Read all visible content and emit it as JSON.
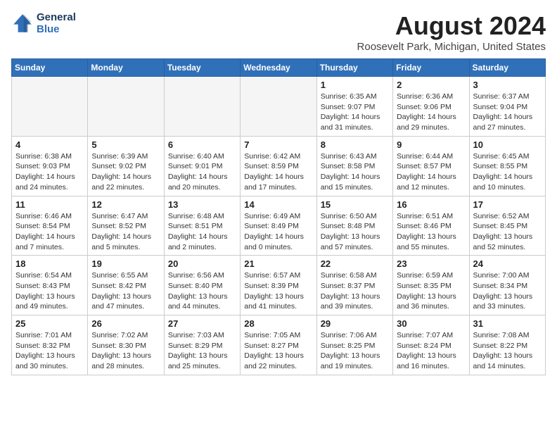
{
  "header": {
    "logo_line1": "General",
    "logo_line2": "Blue",
    "month_year": "August 2024",
    "location": "Roosevelt Park, Michigan, United States"
  },
  "days_of_week": [
    "Sunday",
    "Monday",
    "Tuesday",
    "Wednesday",
    "Thursday",
    "Friday",
    "Saturday"
  ],
  "weeks": [
    [
      {
        "day": "",
        "info": ""
      },
      {
        "day": "",
        "info": ""
      },
      {
        "day": "",
        "info": ""
      },
      {
        "day": "",
        "info": ""
      },
      {
        "day": "1",
        "info": "Sunrise: 6:35 AM\nSunset: 9:07 PM\nDaylight: 14 hours\nand 31 minutes."
      },
      {
        "day": "2",
        "info": "Sunrise: 6:36 AM\nSunset: 9:06 PM\nDaylight: 14 hours\nand 29 minutes."
      },
      {
        "day": "3",
        "info": "Sunrise: 6:37 AM\nSunset: 9:04 PM\nDaylight: 14 hours\nand 27 minutes."
      }
    ],
    [
      {
        "day": "4",
        "info": "Sunrise: 6:38 AM\nSunset: 9:03 PM\nDaylight: 14 hours\nand 24 minutes."
      },
      {
        "day": "5",
        "info": "Sunrise: 6:39 AM\nSunset: 9:02 PM\nDaylight: 14 hours\nand 22 minutes."
      },
      {
        "day": "6",
        "info": "Sunrise: 6:40 AM\nSunset: 9:01 PM\nDaylight: 14 hours\nand 20 minutes."
      },
      {
        "day": "7",
        "info": "Sunrise: 6:42 AM\nSunset: 8:59 PM\nDaylight: 14 hours\nand 17 minutes."
      },
      {
        "day": "8",
        "info": "Sunrise: 6:43 AM\nSunset: 8:58 PM\nDaylight: 14 hours\nand 15 minutes."
      },
      {
        "day": "9",
        "info": "Sunrise: 6:44 AM\nSunset: 8:57 PM\nDaylight: 14 hours\nand 12 minutes."
      },
      {
        "day": "10",
        "info": "Sunrise: 6:45 AM\nSunset: 8:55 PM\nDaylight: 14 hours\nand 10 minutes."
      }
    ],
    [
      {
        "day": "11",
        "info": "Sunrise: 6:46 AM\nSunset: 8:54 PM\nDaylight: 14 hours\nand 7 minutes."
      },
      {
        "day": "12",
        "info": "Sunrise: 6:47 AM\nSunset: 8:52 PM\nDaylight: 14 hours\nand 5 minutes."
      },
      {
        "day": "13",
        "info": "Sunrise: 6:48 AM\nSunset: 8:51 PM\nDaylight: 14 hours\nand 2 minutes."
      },
      {
        "day": "14",
        "info": "Sunrise: 6:49 AM\nSunset: 8:49 PM\nDaylight: 14 hours\nand 0 minutes."
      },
      {
        "day": "15",
        "info": "Sunrise: 6:50 AM\nSunset: 8:48 PM\nDaylight: 13 hours\nand 57 minutes."
      },
      {
        "day": "16",
        "info": "Sunrise: 6:51 AM\nSunset: 8:46 PM\nDaylight: 13 hours\nand 55 minutes."
      },
      {
        "day": "17",
        "info": "Sunrise: 6:52 AM\nSunset: 8:45 PM\nDaylight: 13 hours\nand 52 minutes."
      }
    ],
    [
      {
        "day": "18",
        "info": "Sunrise: 6:54 AM\nSunset: 8:43 PM\nDaylight: 13 hours\nand 49 minutes."
      },
      {
        "day": "19",
        "info": "Sunrise: 6:55 AM\nSunset: 8:42 PM\nDaylight: 13 hours\nand 47 minutes."
      },
      {
        "day": "20",
        "info": "Sunrise: 6:56 AM\nSunset: 8:40 PM\nDaylight: 13 hours\nand 44 minutes."
      },
      {
        "day": "21",
        "info": "Sunrise: 6:57 AM\nSunset: 8:39 PM\nDaylight: 13 hours\nand 41 minutes."
      },
      {
        "day": "22",
        "info": "Sunrise: 6:58 AM\nSunset: 8:37 PM\nDaylight: 13 hours\nand 39 minutes."
      },
      {
        "day": "23",
        "info": "Sunrise: 6:59 AM\nSunset: 8:35 PM\nDaylight: 13 hours\nand 36 minutes."
      },
      {
        "day": "24",
        "info": "Sunrise: 7:00 AM\nSunset: 8:34 PM\nDaylight: 13 hours\nand 33 minutes."
      }
    ],
    [
      {
        "day": "25",
        "info": "Sunrise: 7:01 AM\nSunset: 8:32 PM\nDaylight: 13 hours\nand 30 minutes."
      },
      {
        "day": "26",
        "info": "Sunrise: 7:02 AM\nSunset: 8:30 PM\nDaylight: 13 hours\nand 28 minutes."
      },
      {
        "day": "27",
        "info": "Sunrise: 7:03 AM\nSunset: 8:29 PM\nDaylight: 13 hours\nand 25 minutes."
      },
      {
        "day": "28",
        "info": "Sunrise: 7:05 AM\nSunset: 8:27 PM\nDaylight: 13 hours\nand 22 minutes."
      },
      {
        "day": "29",
        "info": "Sunrise: 7:06 AM\nSunset: 8:25 PM\nDaylight: 13 hours\nand 19 minutes."
      },
      {
        "day": "30",
        "info": "Sunrise: 7:07 AM\nSunset: 8:24 PM\nDaylight: 13 hours\nand 16 minutes."
      },
      {
        "day": "31",
        "info": "Sunrise: 7:08 AM\nSunset: 8:22 PM\nDaylight: 13 hours\nand 14 minutes."
      }
    ]
  ]
}
